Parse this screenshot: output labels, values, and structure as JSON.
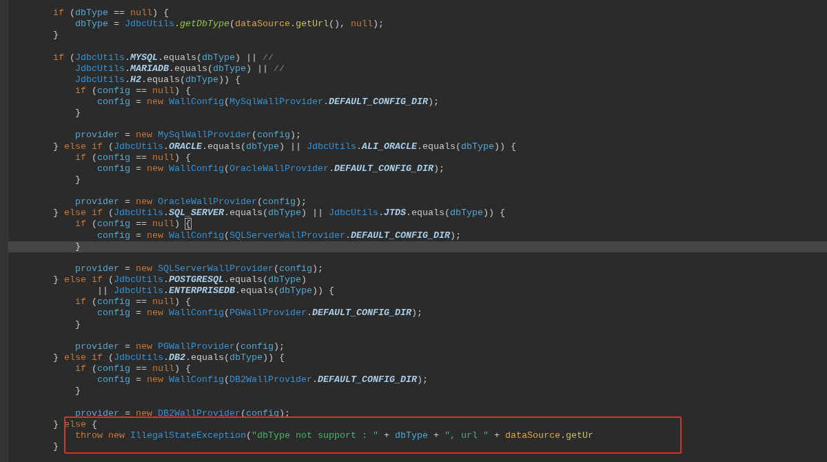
{
  "editor": {
    "lines": [
      {
        "current": false,
        "tokens": [
          {
            "text": "        if",
            "kind": "keyword"
          },
          {
            "text": " (",
            "kind": "plain"
          },
          {
            "text": "dbType",
            "kind": "var"
          },
          {
            "text": " == ",
            "kind": "plain"
          },
          {
            "text": "null",
            "kind": "keyword"
          },
          {
            "text": ") {",
            "kind": "plain"
          }
        ]
      },
      {
        "current": false,
        "tokens": [
          {
            "text": "            dbType",
            "kind": "var"
          },
          {
            "text": " = ",
            "kind": "plain"
          },
          {
            "text": "JdbcUtils",
            "kind": "class"
          },
          {
            "text": ".",
            "kind": "plain"
          },
          {
            "text": "getDbType",
            "kind": "static-method"
          },
          {
            "text": "(",
            "kind": "plain"
          },
          {
            "text": "dataSource",
            "kind": "param"
          },
          {
            "text": ".",
            "kind": "plain"
          },
          {
            "text": "getUrl",
            "kind": "call"
          },
          {
            "text": "(), ",
            "kind": "plain"
          },
          {
            "text": "null",
            "kind": "keyword"
          },
          {
            "text": ");",
            "kind": "plain"
          }
        ]
      },
      {
        "current": false,
        "tokens": [
          {
            "text": "        }",
            "kind": "plain"
          }
        ]
      },
      {
        "current": false
      },
      {
        "current": false,
        "tokens": [
          {
            "text": "        if",
            "kind": "keyword"
          },
          {
            "text": " (",
            "kind": "plain"
          },
          {
            "text": "JdbcUtils",
            "kind": "class"
          },
          {
            "text": ".",
            "kind": "plain"
          },
          {
            "text": "MYSQL",
            "kind": "constant"
          },
          {
            "text": ".equals(",
            "kind": "plain"
          },
          {
            "text": "dbType",
            "kind": "var"
          },
          {
            "text": ") || ",
            "kind": "plain"
          },
          {
            "text": "//",
            "kind": "comment"
          }
        ]
      },
      {
        "current": false,
        "tokens": [
          {
            "text": "            JdbcUtils",
            "kind": "class"
          },
          {
            "text": ".",
            "kind": "plain"
          },
          {
            "text": "MARIADB",
            "kind": "constant"
          },
          {
            "text": ".equals(",
            "kind": "plain"
          },
          {
            "text": "dbType",
            "kind": "var"
          },
          {
            "text": ") || ",
            "kind": "plain"
          },
          {
            "text": "//",
            "kind": "comment"
          }
        ]
      },
      {
        "current": false,
        "tokens": [
          {
            "text": "            JdbcUtils",
            "kind": "class"
          },
          {
            "text": ".",
            "kind": "plain"
          },
          {
            "text": "H2",
            "kind": "constant"
          },
          {
            "text": ".equals(",
            "kind": "plain"
          },
          {
            "text": "dbType",
            "kind": "var"
          },
          {
            "text": ")) {",
            "kind": "plain"
          }
        ]
      },
      {
        "current": false,
        "tokens": [
          {
            "text": "            if",
            "kind": "keyword"
          },
          {
            "text": " (",
            "kind": "plain"
          },
          {
            "text": "config",
            "kind": "var"
          },
          {
            "text": " == ",
            "kind": "plain"
          },
          {
            "text": "null",
            "kind": "keyword"
          },
          {
            "text": ") {",
            "kind": "plain"
          }
        ]
      },
      {
        "current": false,
        "tokens": [
          {
            "text": "                config",
            "kind": "var"
          },
          {
            "text": " = ",
            "kind": "plain"
          },
          {
            "text": "new ",
            "kind": "keyword"
          },
          {
            "text": "WallConfig",
            "kind": "class"
          },
          {
            "text": "(",
            "kind": "plain"
          },
          {
            "text": "MySqlWallProvider",
            "kind": "class"
          },
          {
            "text": ".",
            "kind": "plain"
          },
          {
            "text": "DEFAULT_CONFIG_DIR",
            "kind": "constant"
          },
          {
            "text": ");",
            "kind": "plain"
          }
        ]
      },
      {
        "current": false,
        "tokens": [
          {
            "text": "            }",
            "kind": "plain"
          }
        ]
      },
      {
        "current": false
      },
      {
        "current": false,
        "tokens": [
          {
            "text": "            provider",
            "kind": "var"
          },
          {
            "text": " = ",
            "kind": "plain"
          },
          {
            "text": "new ",
            "kind": "keyword"
          },
          {
            "text": "MySqlWallProvider",
            "kind": "class"
          },
          {
            "text": "(",
            "kind": "plain"
          },
          {
            "text": "config",
            "kind": "var"
          },
          {
            "text": ");",
            "kind": "plain"
          }
        ]
      },
      {
        "current": false,
        "tokens": [
          {
            "text": "        } ",
            "kind": "plain"
          },
          {
            "text": "else if",
            "kind": "keyword"
          },
          {
            "text": " (",
            "kind": "plain"
          },
          {
            "text": "JdbcUtils",
            "kind": "class"
          },
          {
            "text": ".",
            "kind": "plain"
          },
          {
            "text": "ORACLE",
            "kind": "constant"
          },
          {
            "text": ".equals(",
            "kind": "plain"
          },
          {
            "text": "dbType",
            "kind": "var"
          },
          {
            "text": ") || ",
            "kind": "plain"
          },
          {
            "text": "JdbcUtils",
            "kind": "class"
          },
          {
            "text": ".",
            "kind": "plain"
          },
          {
            "text": "ALI_ORACLE",
            "kind": "constant"
          },
          {
            "text": ".equals(",
            "kind": "plain"
          },
          {
            "text": "dbType",
            "kind": "var"
          },
          {
            "text": ")) {",
            "kind": "plain"
          }
        ]
      },
      {
        "current": false,
        "tokens": [
          {
            "text": "            if",
            "kind": "keyword"
          },
          {
            "text": " (",
            "kind": "plain"
          },
          {
            "text": "config",
            "kind": "var"
          },
          {
            "text": " == ",
            "kind": "plain"
          },
          {
            "text": "null",
            "kind": "keyword"
          },
          {
            "text": ") {",
            "kind": "plain"
          }
        ]
      },
      {
        "current": false,
        "tokens": [
          {
            "text": "                config",
            "kind": "var"
          },
          {
            "text": " = ",
            "kind": "plain"
          },
          {
            "text": "new ",
            "kind": "keyword"
          },
          {
            "text": "WallConfig",
            "kind": "class"
          },
          {
            "text": "(",
            "kind": "plain"
          },
          {
            "text": "OracleWallProvider",
            "kind": "class"
          },
          {
            "text": ".",
            "kind": "plain"
          },
          {
            "text": "DEFAULT_CONFIG_DIR",
            "kind": "constant"
          },
          {
            "text": ");",
            "kind": "plain"
          }
        ]
      },
      {
        "current": false,
        "tokens": [
          {
            "text": "            }",
            "kind": "plain"
          }
        ]
      },
      {
        "current": false
      },
      {
        "current": false,
        "tokens": [
          {
            "text": "            provider",
            "kind": "var"
          },
          {
            "text": " = ",
            "kind": "plain"
          },
          {
            "text": "new ",
            "kind": "keyword"
          },
          {
            "text": "OracleWallProvider",
            "kind": "class"
          },
          {
            "text": "(",
            "kind": "plain"
          },
          {
            "text": "config",
            "kind": "var"
          },
          {
            "text": ");",
            "kind": "plain"
          }
        ]
      },
      {
        "current": false,
        "tokens": [
          {
            "text": "        } ",
            "kind": "plain"
          },
          {
            "text": "else if",
            "kind": "keyword"
          },
          {
            "text": " (",
            "kind": "plain"
          },
          {
            "text": "JdbcUtils",
            "kind": "class"
          },
          {
            "text": ".",
            "kind": "plain"
          },
          {
            "text": "SQL_SERVER",
            "kind": "constant"
          },
          {
            "text": ".equals(",
            "kind": "plain"
          },
          {
            "text": "dbType",
            "kind": "var"
          },
          {
            "text": ") || ",
            "kind": "plain"
          },
          {
            "text": "JdbcUtils",
            "kind": "class"
          },
          {
            "text": ".",
            "kind": "plain"
          },
          {
            "text": "JTDS",
            "kind": "constant"
          },
          {
            "text": ".equals(",
            "kind": "plain"
          },
          {
            "text": "dbType",
            "kind": "var"
          },
          {
            "text": ")) {",
            "kind": "plain"
          }
        ]
      },
      {
        "current": false,
        "tokens": [
          {
            "text": "            if",
            "kind": "keyword"
          },
          {
            "text": " (",
            "kind": "plain"
          },
          {
            "text": "config",
            "kind": "var"
          },
          {
            "text": " == ",
            "kind": "plain"
          },
          {
            "text": "null",
            "kind": "keyword"
          },
          {
            "text": ") ",
            "kind": "plain"
          },
          {
            "text": "{",
            "kind": "brace-match"
          }
        ]
      },
      {
        "current": false,
        "tokens": [
          {
            "text": "                config",
            "kind": "var"
          },
          {
            "text": " = ",
            "kind": "plain"
          },
          {
            "text": "new ",
            "kind": "keyword"
          },
          {
            "text": "WallConfig",
            "kind": "class"
          },
          {
            "text": "(",
            "kind": "plain"
          },
          {
            "text": "SQLServerWallProvider",
            "kind": "class"
          },
          {
            "text": ".",
            "kind": "plain"
          },
          {
            "text": "DEFAULT_CONFIG_DIR",
            "kind": "constant"
          },
          {
            "text": ");",
            "kind": "plain"
          }
        ]
      },
      {
        "current": true,
        "tokens": [
          {
            "text": "            }",
            "kind": "plain"
          }
        ]
      },
      {
        "current": false
      },
      {
        "current": false,
        "tokens": [
          {
            "text": "            provider",
            "kind": "var"
          },
          {
            "text": " = ",
            "kind": "plain"
          },
          {
            "text": "new ",
            "kind": "keyword"
          },
          {
            "text": "SQLServerWallProvider",
            "kind": "class"
          },
          {
            "text": "(",
            "kind": "plain"
          },
          {
            "text": "config",
            "kind": "var"
          },
          {
            "text": ");",
            "kind": "plain"
          }
        ]
      },
      {
        "current": false,
        "tokens": [
          {
            "text": "        } ",
            "kind": "plain"
          },
          {
            "text": "else if",
            "kind": "keyword"
          },
          {
            "text": " (",
            "kind": "plain"
          },
          {
            "text": "JdbcUtils",
            "kind": "class"
          },
          {
            "text": ".",
            "kind": "plain"
          },
          {
            "text": "POSTGRESQL",
            "kind": "constant"
          },
          {
            "text": ".equals(",
            "kind": "plain"
          },
          {
            "text": "dbType",
            "kind": "var"
          },
          {
            "text": ")",
            "kind": "plain"
          }
        ]
      },
      {
        "current": false,
        "tokens": [
          {
            "text": "                || ",
            "kind": "plain"
          },
          {
            "text": "JdbcUtils",
            "kind": "class"
          },
          {
            "text": ".",
            "kind": "plain"
          },
          {
            "text": "ENTERPRISEDB",
            "kind": "constant"
          },
          {
            "text": ".equals(",
            "kind": "plain"
          },
          {
            "text": "dbType",
            "kind": "var"
          },
          {
            "text": ")) {",
            "kind": "plain"
          }
        ]
      },
      {
        "current": false,
        "tokens": [
          {
            "text": "            if",
            "kind": "keyword"
          },
          {
            "text": " (",
            "kind": "plain"
          },
          {
            "text": "config",
            "kind": "var"
          },
          {
            "text": " == ",
            "kind": "plain"
          },
          {
            "text": "null",
            "kind": "keyword"
          },
          {
            "text": ") {",
            "kind": "plain"
          }
        ]
      },
      {
        "current": false,
        "tokens": [
          {
            "text": "                config",
            "kind": "var"
          },
          {
            "text": " = ",
            "kind": "plain"
          },
          {
            "text": "new ",
            "kind": "keyword"
          },
          {
            "text": "WallConfig",
            "kind": "class"
          },
          {
            "text": "(",
            "kind": "plain"
          },
          {
            "text": "PGWallProvider",
            "kind": "class"
          },
          {
            "text": ".",
            "kind": "plain"
          },
          {
            "text": "DEFAULT_CONFIG_DIR",
            "kind": "constant"
          },
          {
            "text": ");",
            "kind": "plain"
          }
        ]
      },
      {
        "current": false,
        "tokens": [
          {
            "text": "            }",
            "kind": "plain"
          }
        ]
      },
      {
        "current": false
      },
      {
        "current": false,
        "tokens": [
          {
            "text": "            provider",
            "kind": "var"
          },
          {
            "text": " = ",
            "kind": "plain"
          },
          {
            "text": "new ",
            "kind": "keyword"
          },
          {
            "text": "PGWallProvider",
            "kind": "class"
          },
          {
            "text": "(",
            "kind": "plain"
          },
          {
            "text": "config",
            "kind": "var"
          },
          {
            "text": ");",
            "kind": "plain"
          }
        ]
      },
      {
        "current": false,
        "tokens": [
          {
            "text": "        } ",
            "kind": "plain"
          },
          {
            "text": "else if",
            "kind": "keyword"
          },
          {
            "text": " (",
            "kind": "plain"
          },
          {
            "text": "JdbcUtils",
            "kind": "class"
          },
          {
            "text": ".",
            "kind": "plain"
          },
          {
            "text": "DB2",
            "kind": "constant"
          },
          {
            "text": ".equals(",
            "kind": "plain"
          },
          {
            "text": "dbType",
            "kind": "var"
          },
          {
            "text": ")) {",
            "kind": "plain"
          }
        ]
      },
      {
        "current": false,
        "tokens": [
          {
            "text": "            if",
            "kind": "keyword"
          },
          {
            "text": " (",
            "kind": "plain"
          },
          {
            "text": "config",
            "kind": "var"
          },
          {
            "text": " == ",
            "kind": "plain"
          },
          {
            "text": "null",
            "kind": "keyword"
          },
          {
            "text": ") {",
            "kind": "plain"
          }
        ]
      },
      {
        "current": false,
        "tokens": [
          {
            "text": "                config",
            "kind": "var"
          },
          {
            "text": " = ",
            "kind": "plain"
          },
          {
            "text": "new ",
            "kind": "keyword"
          },
          {
            "text": "WallConfig",
            "kind": "class"
          },
          {
            "text": "(",
            "kind": "plain"
          },
          {
            "text": "DB2WallProvider",
            "kind": "class"
          },
          {
            "text": ".",
            "kind": "plain"
          },
          {
            "text": "DEFAULT_CONFIG_DIR",
            "kind": "constant"
          },
          {
            "text": ");",
            "kind": "plain"
          }
        ]
      },
      {
        "current": false,
        "tokens": [
          {
            "text": "            }",
            "kind": "plain"
          }
        ]
      },
      {
        "current": false
      },
      {
        "current": false,
        "tokens": [
          {
            "text": "            provider",
            "kind": "var"
          },
          {
            "text": " = ",
            "kind": "plain"
          },
          {
            "text": "new ",
            "kind": "keyword"
          },
          {
            "text": "DB2WallProvider",
            "kind": "class"
          },
          {
            "text": "(",
            "kind": "plain"
          },
          {
            "text": "config",
            "kind": "var"
          },
          {
            "text": ");",
            "kind": "plain"
          }
        ]
      },
      {
        "current": false,
        "tokens": [
          {
            "text": "        } ",
            "kind": "plain"
          },
          {
            "text": "else",
            "kind": "keyword"
          },
          {
            "text": " {",
            "kind": "plain"
          }
        ]
      },
      {
        "current": false,
        "tokens": [
          {
            "text": "            throw new ",
            "kind": "keyword"
          },
          {
            "text": "IllegalStateException",
            "kind": "class"
          },
          {
            "text": "(",
            "kind": "plain"
          },
          {
            "text": "\"dbType not support : \"",
            "kind": "string"
          },
          {
            "text": " + ",
            "kind": "plain"
          },
          {
            "text": "dbType",
            "kind": "var"
          },
          {
            "text": " + ",
            "kind": "plain"
          },
          {
            "text": "\", url \"",
            "kind": "string"
          },
          {
            "text": " + ",
            "kind": "plain"
          },
          {
            "text": "dataSource",
            "kind": "param"
          },
          {
            "text": ".",
            "kind": "plain"
          },
          {
            "text": "getUr",
            "kind": "call"
          }
        ]
      },
      {
        "current": false,
        "tokens": [
          {
            "text": "        }",
            "kind": "plain"
          }
        ]
      }
    ]
  }
}
